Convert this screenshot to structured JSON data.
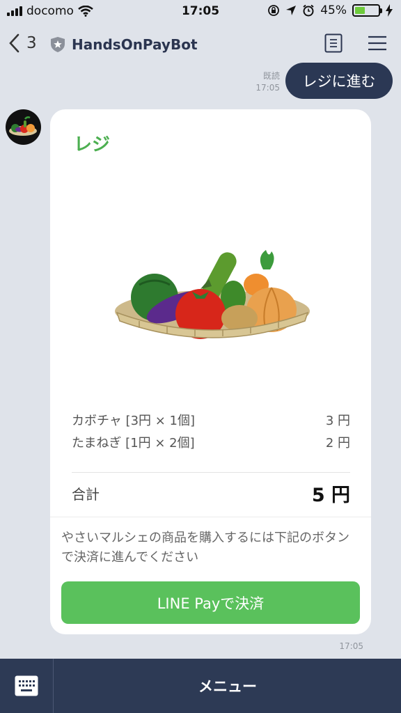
{
  "status_bar": {
    "carrier": "docomo",
    "time": "17:05",
    "battery_percent": "45%",
    "battery_level": 0.45,
    "icons": [
      "signal-icon",
      "wifi-icon",
      "rotation-lock-icon",
      "location-icon",
      "alarm-icon",
      "battery-icon",
      "charging-icon"
    ]
  },
  "header": {
    "back_count": "3",
    "title": "HandsOnPayBot",
    "icons": [
      "back-chevron-icon",
      "shield-star-icon",
      "note-icon",
      "menu-icon"
    ]
  },
  "outgoing": {
    "read_label": "既読",
    "time": "17:05",
    "text": "レジに進む"
  },
  "card": {
    "title": "レジ",
    "items": [
      {
        "name": "カボチャ [3円 × 1個]",
        "price": "3 円"
      },
      {
        "name": "たまねぎ [1円 × 2個]",
        "price": "2 円"
      }
    ],
    "total_label": "合計",
    "total_value": "5 円",
    "note": "やさいマルシェの商品を購入するには下記のボタンで決済に進んでください",
    "pay_button": "LINE Payで決済",
    "time": "17:05"
  },
  "bottom": {
    "menu_label": "メニュー",
    "icons": [
      "keyboard-icon"
    ]
  },
  "colors": {
    "accent_green": "#4caf50",
    "button_green": "#5ac15c",
    "navy": "#2b3854",
    "background": "#dfe3ea"
  }
}
